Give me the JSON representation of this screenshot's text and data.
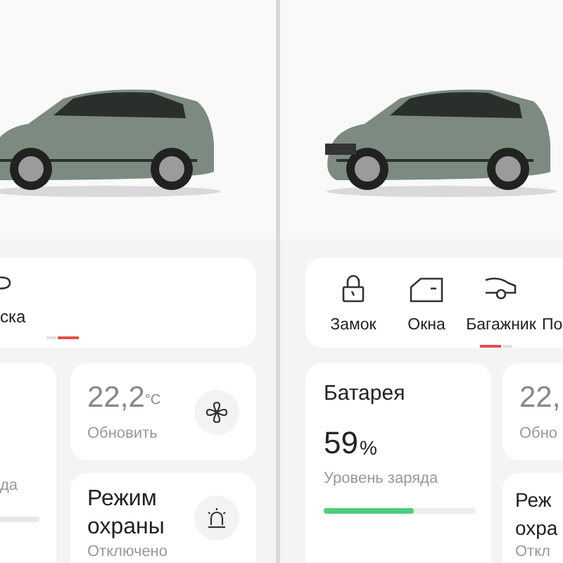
{
  "screens": [
    {
      "controls": [
        {
          "label": "ска",
          "kind": "curve"
        }
      ],
      "battery": {
        "status": "да"
      },
      "climate": {
        "temperature": "22,2",
        "unit": "°C",
        "action": "Обновить"
      },
      "security": {
        "title_lines": [
          "Режим",
          "охраны"
        ],
        "status": "Отключено"
      }
    },
    {
      "controls": [
        {
          "label": "Замок",
          "kind": "lock"
        },
        {
          "label": "Окна",
          "kind": "door"
        },
        {
          "label": "Багажник",
          "kind": "trunk"
        },
        {
          "label": "По",
          "kind": "plain"
        }
      ],
      "battery": {
        "title": "Батарея",
        "value": "59",
        "unit": "%",
        "status": "Уровень заряда",
        "level": 0.59
      },
      "climate": {
        "temperature": "22,",
        "action": "Обно"
      },
      "security": {
        "title_lines": [
          "Реж",
          "охра"
        ],
        "status": "Откл"
      }
    }
  ]
}
